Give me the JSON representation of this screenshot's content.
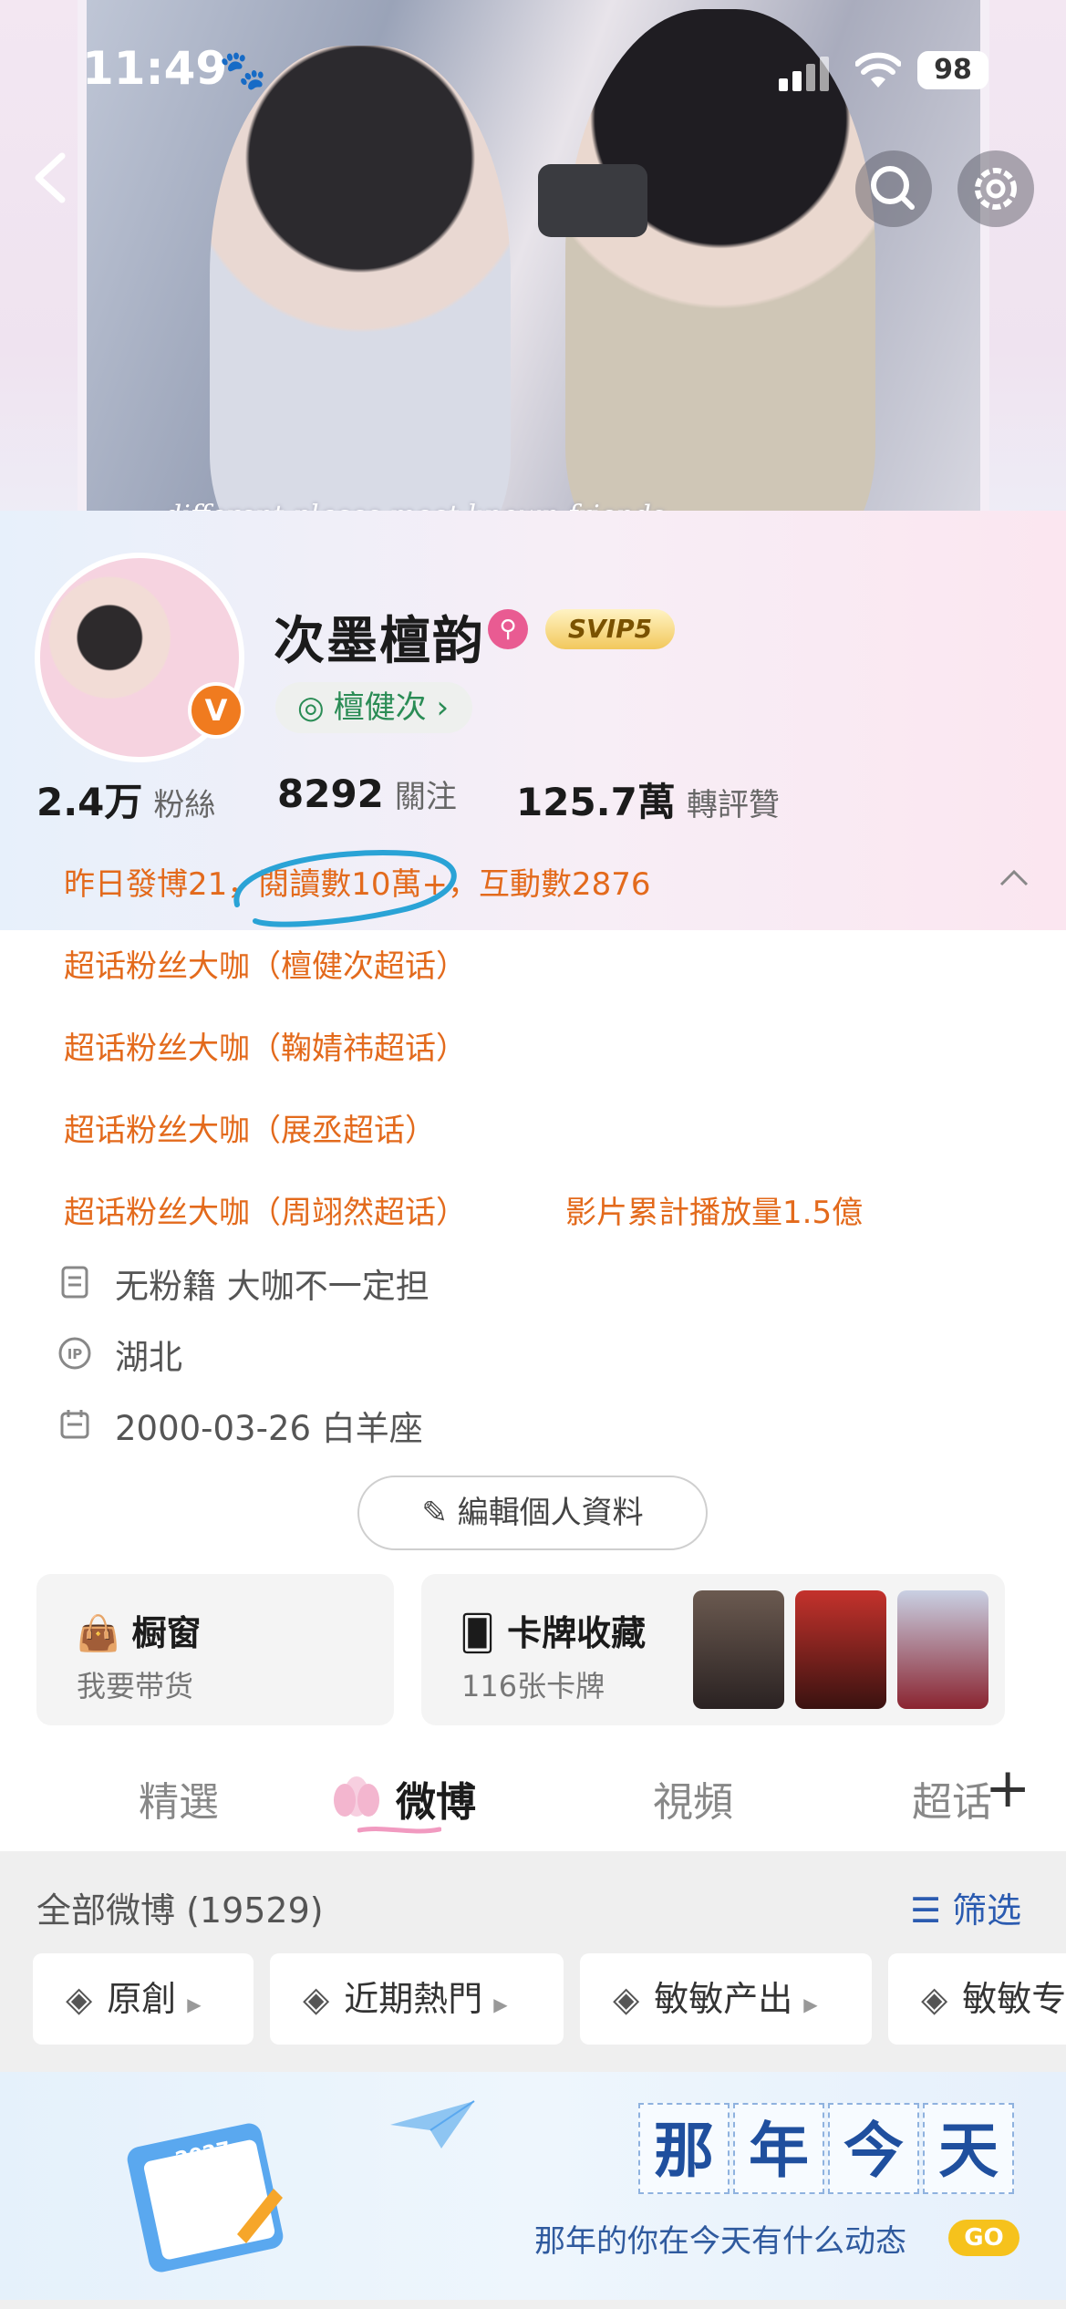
{
  "status_bar": {
    "time": "11:49",
    "battery": "98"
  },
  "cover": {
    "caption": "different places meet known friends"
  },
  "profile": {
    "username": "次墨檀韵",
    "svip_badge": "SVIP5",
    "verify_badge": "V",
    "linked_account": "檀健次",
    "stats": [
      {
        "value": "2.4万",
        "label": "粉絲"
      },
      {
        "value": "8292",
        "label": "關注"
      },
      {
        "value": "125.7萬",
        "label": "轉評贊"
      }
    ],
    "achievements": [
      "昨日發博21，閱讀數10萬+，互動數2876",
      "超话粉丝大咖（檀健次超话）",
      "超话粉丝大咖（鞠婧祎超话）",
      "超话粉丝大咖（展丞超话）",
      "超话粉丝大咖（周翊然超话）"
    ],
    "video_plays": "影片累計播放量1.5億",
    "bio": "无粉籍 大咖不一定担",
    "ip_location": "湖北",
    "birthday": "2000-03-26 白羊座",
    "edit_label": "編輯個人資料"
  },
  "cards": {
    "shop": {
      "title": "橱窗",
      "subtitle": "我要带货"
    },
    "collection": {
      "title": "卡牌收藏",
      "subtitle": "116张卡牌"
    }
  },
  "tabs": [
    "精選",
    "微博",
    "視頻",
    "超话"
  ],
  "active_tab": "微博",
  "feed": {
    "all_label": "全部微博 (19529)",
    "filter_label": "筛选",
    "chips": [
      "原創",
      "近期熱門",
      "敏敏产出",
      "敏敏专"
    ]
  },
  "memory_banner": {
    "chars": [
      "那",
      "年",
      "今",
      "天"
    ],
    "subtitle": "那年的你在今天有什么动态",
    "go": "GO",
    "calendar_year": "2027"
  },
  "icons": {
    "paw": "paw-icon",
    "back": "back-icon",
    "search": "search-icon",
    "settings": "gear-icon",
    "bio": "document-icon",
    "ip": "ip-icon",
    "birthday": "calendar-icon",
    "edit": "pencil-icon",
    "shop": "shopping-bag-icon",
    "collection": "card-icon",
    "filter": "filter-icon",
    "layers": "layers-icon"
  },
  "colors": {
    "accent_orange": "#e36a1c",
    "link_green": "#2a8c55",
    "filter_blue": "#2b5bb0",
    "go_yellow": "#f6c21c"
  }
}
